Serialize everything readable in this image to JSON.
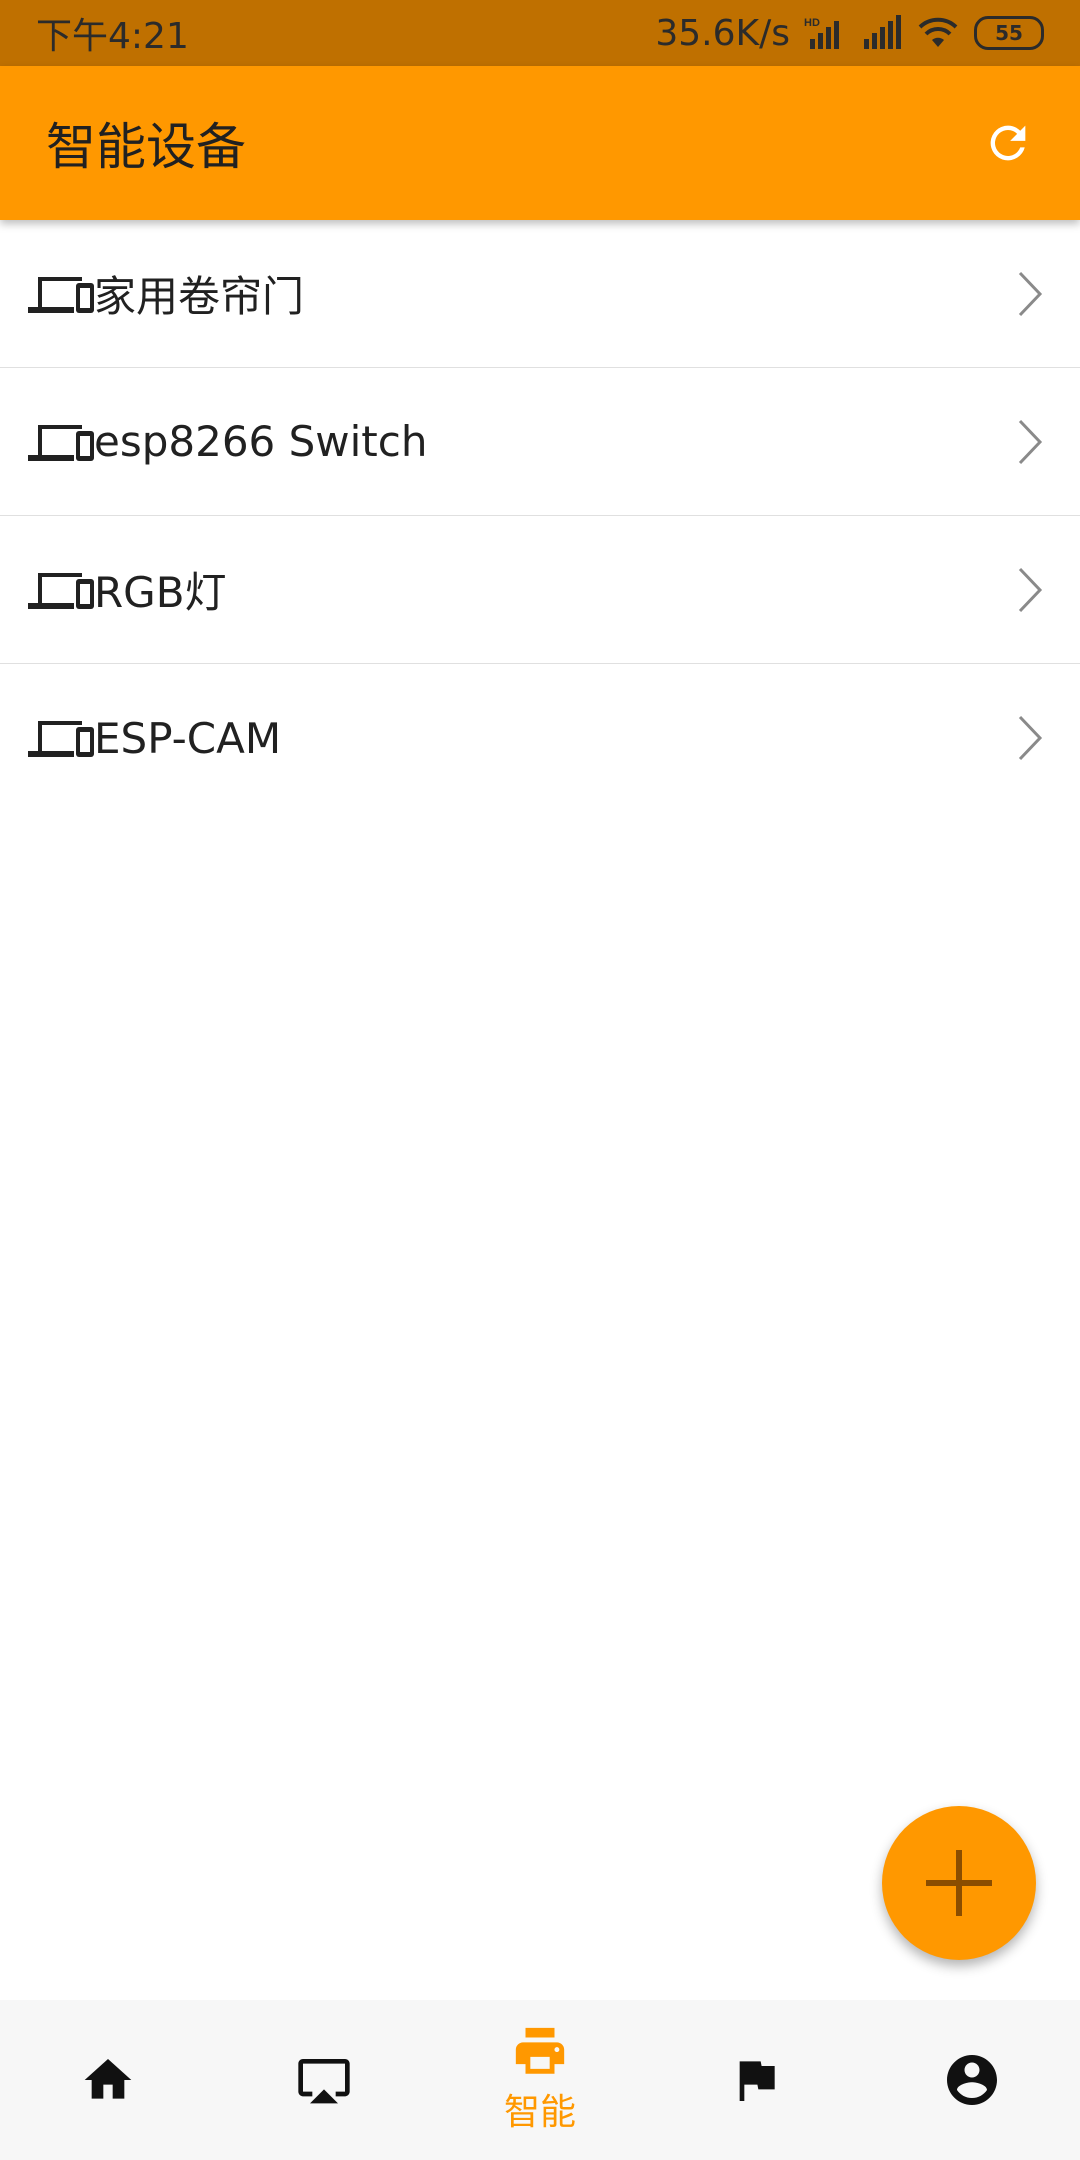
{
  "status_bar": {
    "time": "下午4:21",
    "network_speed": "35.6K/s",
    "hd_label": "HD",
    "battery_level": "55"
  },
  "app_bar": {
    "title": "智能设备",
    "refresh_icon": "refresh-icon"
  },
  "devices": [
    {
      "label": "家用卷帘门",
      "icon": "devices-icon"
    },
    {
      "label": "esp8266 Switch",
      "icon": "devices-icon"
    },
    {
      "label": "RGB灯",
      "icon": "devices-icon"
    },
    {
      "label": "ESP-CAM",
      "icon": "devices-icon"
    }
  ],
  "fab": {
    "icon": "add-icon"
  },
  "bottom_nav": {
    "items": [
      {
        "icon": "home-icon",
        "label": ""
      },
      {
        "icon": "cast-icon",
        "label": ""
      },
      {
        "icon": "printer-icon",
        "label": "智能",
        "active": true
      },
      {
        "icon": "flag-icon",
        "label": ""
      },
      {
        "icon": "account-icon",
        "label": ""
      }
    ]
  },
  "colors": {
    "status_bar": "#BF7000",
    "primary": "#FF9800",
    "text": "#212121",
    "divider": "#E0E0E0",
    "nav_background": "#F7F7F7"
  }
}
